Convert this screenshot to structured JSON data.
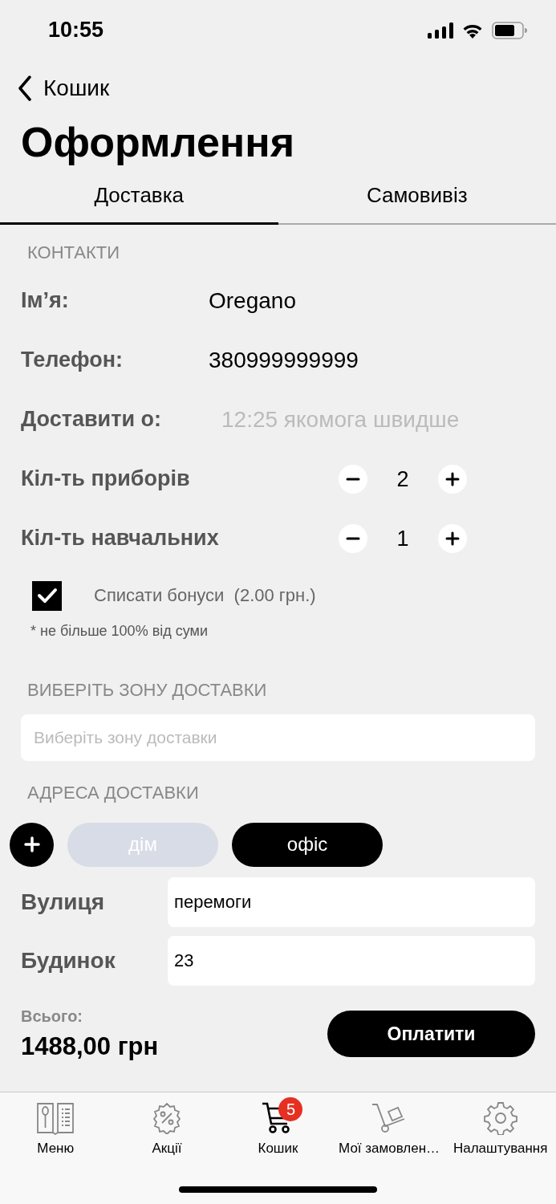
{
  "status_bar": {
    "time": "10:55"
  },
  "back": {
    "label": "Кошик"
  },
  "title": "Оформлення",
  "tabs": [
    {
      "label": "Доставка",
      "selected": true
    },
    {
      "label": "Самовивіз",
      "selected": false
    }
  ],
  "contacts": {
    "header": "КОНТАКТИ",
    "rows": [
      {
        "kind": "value",
        "label": "Ім’я:",
        "value": "Oregano"
      },
      {
        "kind": "value",
        "label": "Телефон:",
        "value": "380999999999"
      },
      {
        "kind": "placeholder",
        "label": "Доставити о:",
        "placeholder": "12:25 якомога швидше"
      },
      {
        "kind": "stepper",
        "label": "Кіл-ть приборів",
        "value": "2"
      },
      {
        "kind": "stepper",
        "label": "Кіл-ть навчальних",
        "value": "1"
      }
    ]
  },
  "bonus": {
    "checked": true,
    "label": "Списати бонуси  (2.00 грн.)",
    "note": "* не більше 100% від суми"
  },
  "zone": {
    "header": "ВИБЕРІТЬ ЗОНУ ДОСТАВКИ",
    "placeholder": "Виберіть зону доставки"
  },
  "address": {
    "header": "АДРЕСА ДОСТАВКИ",
    "chips": [
      {
        "label": "дім",
        "selected": false
      },
      {
        "label": "офіс",
        "selected": true
      }
    ],
    "fields": [
      {
        "label": "Вулиця",
        "value": "перемоги"
      },
      {
        "label": "Будинок",
        "value": "23"
      }
    ]
  },
  "total": {
    "label": "Всього:",
    "amount": "1488,00 грн",
    "button": "Оплатити"
  },
  "tab_bar": [
    {
      "kind": "menu",
      "label": "Меню",
      "selected": false
    },
    {
      "kind": "promo",
      "label": "Акції",
      "selected": false
    },
    {
      "kind": "cart",
      "label": "Кошик",
      "selected": true,
      "badge": "5"
    },
    {
      "kind": "orders",
      "label": "Мої замовлен…",
      "selected": false
    },
    {
      "kind": "settings",
      "label": "Налаштування",
      "selected": false
    }
  ]
}
